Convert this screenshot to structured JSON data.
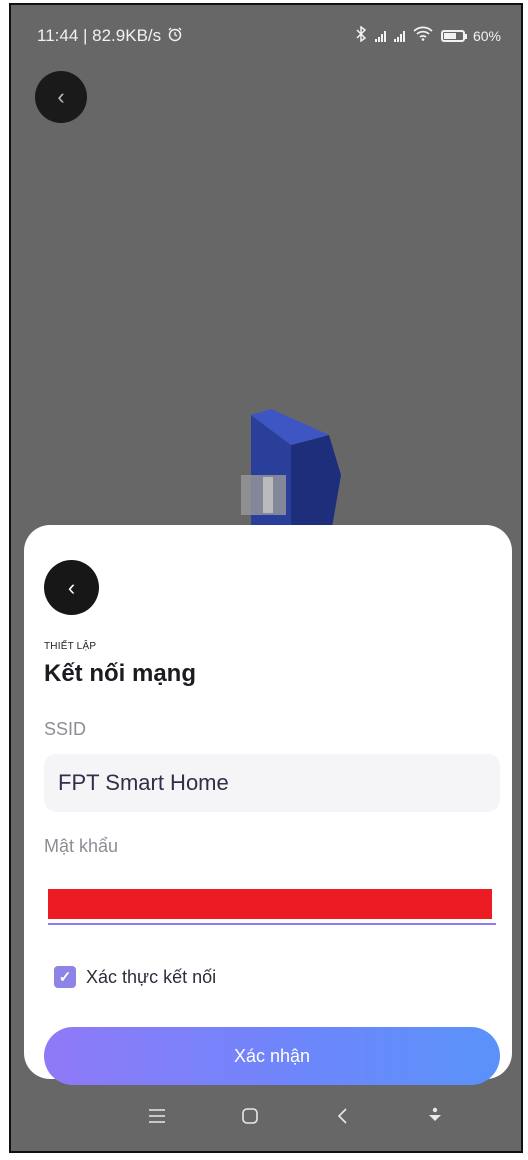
{
  "status_bar": {
    "time_speed": "11:44 | 82.9KB/s",
    "alarm_icon": "alarm-icon",
    "battery_percent": "60%"
  },
  "background": {
    "back_icon": "chevron-left-icon",
    "illustration": "router-illustration"
  },
  "sheet": {
    "back_icon": "chevron-left-icon",
    "eyebrow": "THIẾT LẬP",
    "title": "Kết nối mạng",
    "ssid_label": "SSID",
    "ssid_value": "FPT Smart Home",
    "password_label": "Mật khẩu",
    "verify_label": "Xác thực kết nối",
    "verify_checked": true,
    "confirm_label": "Xác nhận"
  },
  "colors": {
    "accent": "#8e83e6",
    "button_gradient_start": "#8f79f7",
    "button_gradient_end": "#5a92fa",
    "redaction": "#ed1c24"
  },
  "nav_bar": {
    "items": [
      "menu-icon",
      "home-icon",
      "back-icon",
      "assistant-icon"
    ]
  }
}
